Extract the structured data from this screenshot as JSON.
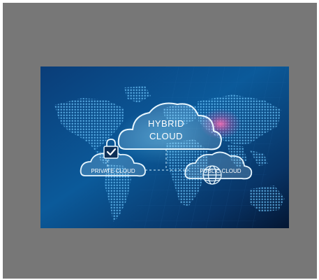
{
  "image": {
    "main_cloud_line1": "HYBRID",
    "main_cloud_line2": "CLOUD",
    "left_cloud_label": "PRIVATE CLOUD",
    "right_cloud_label": "PUBLIC CLOUD",
    "left_icon": "padlock-check-icon",
    "right_icon": "globe-icon",
    "colors": {
      "outer_frame": "#777777",
      "background_dark": "#061a3a",
      "background_mid": "#0a4a86",
      "accent_cyan": "#5fd0ff",
      "accent_pink": "#ff5fa8"
    }
  }
}
